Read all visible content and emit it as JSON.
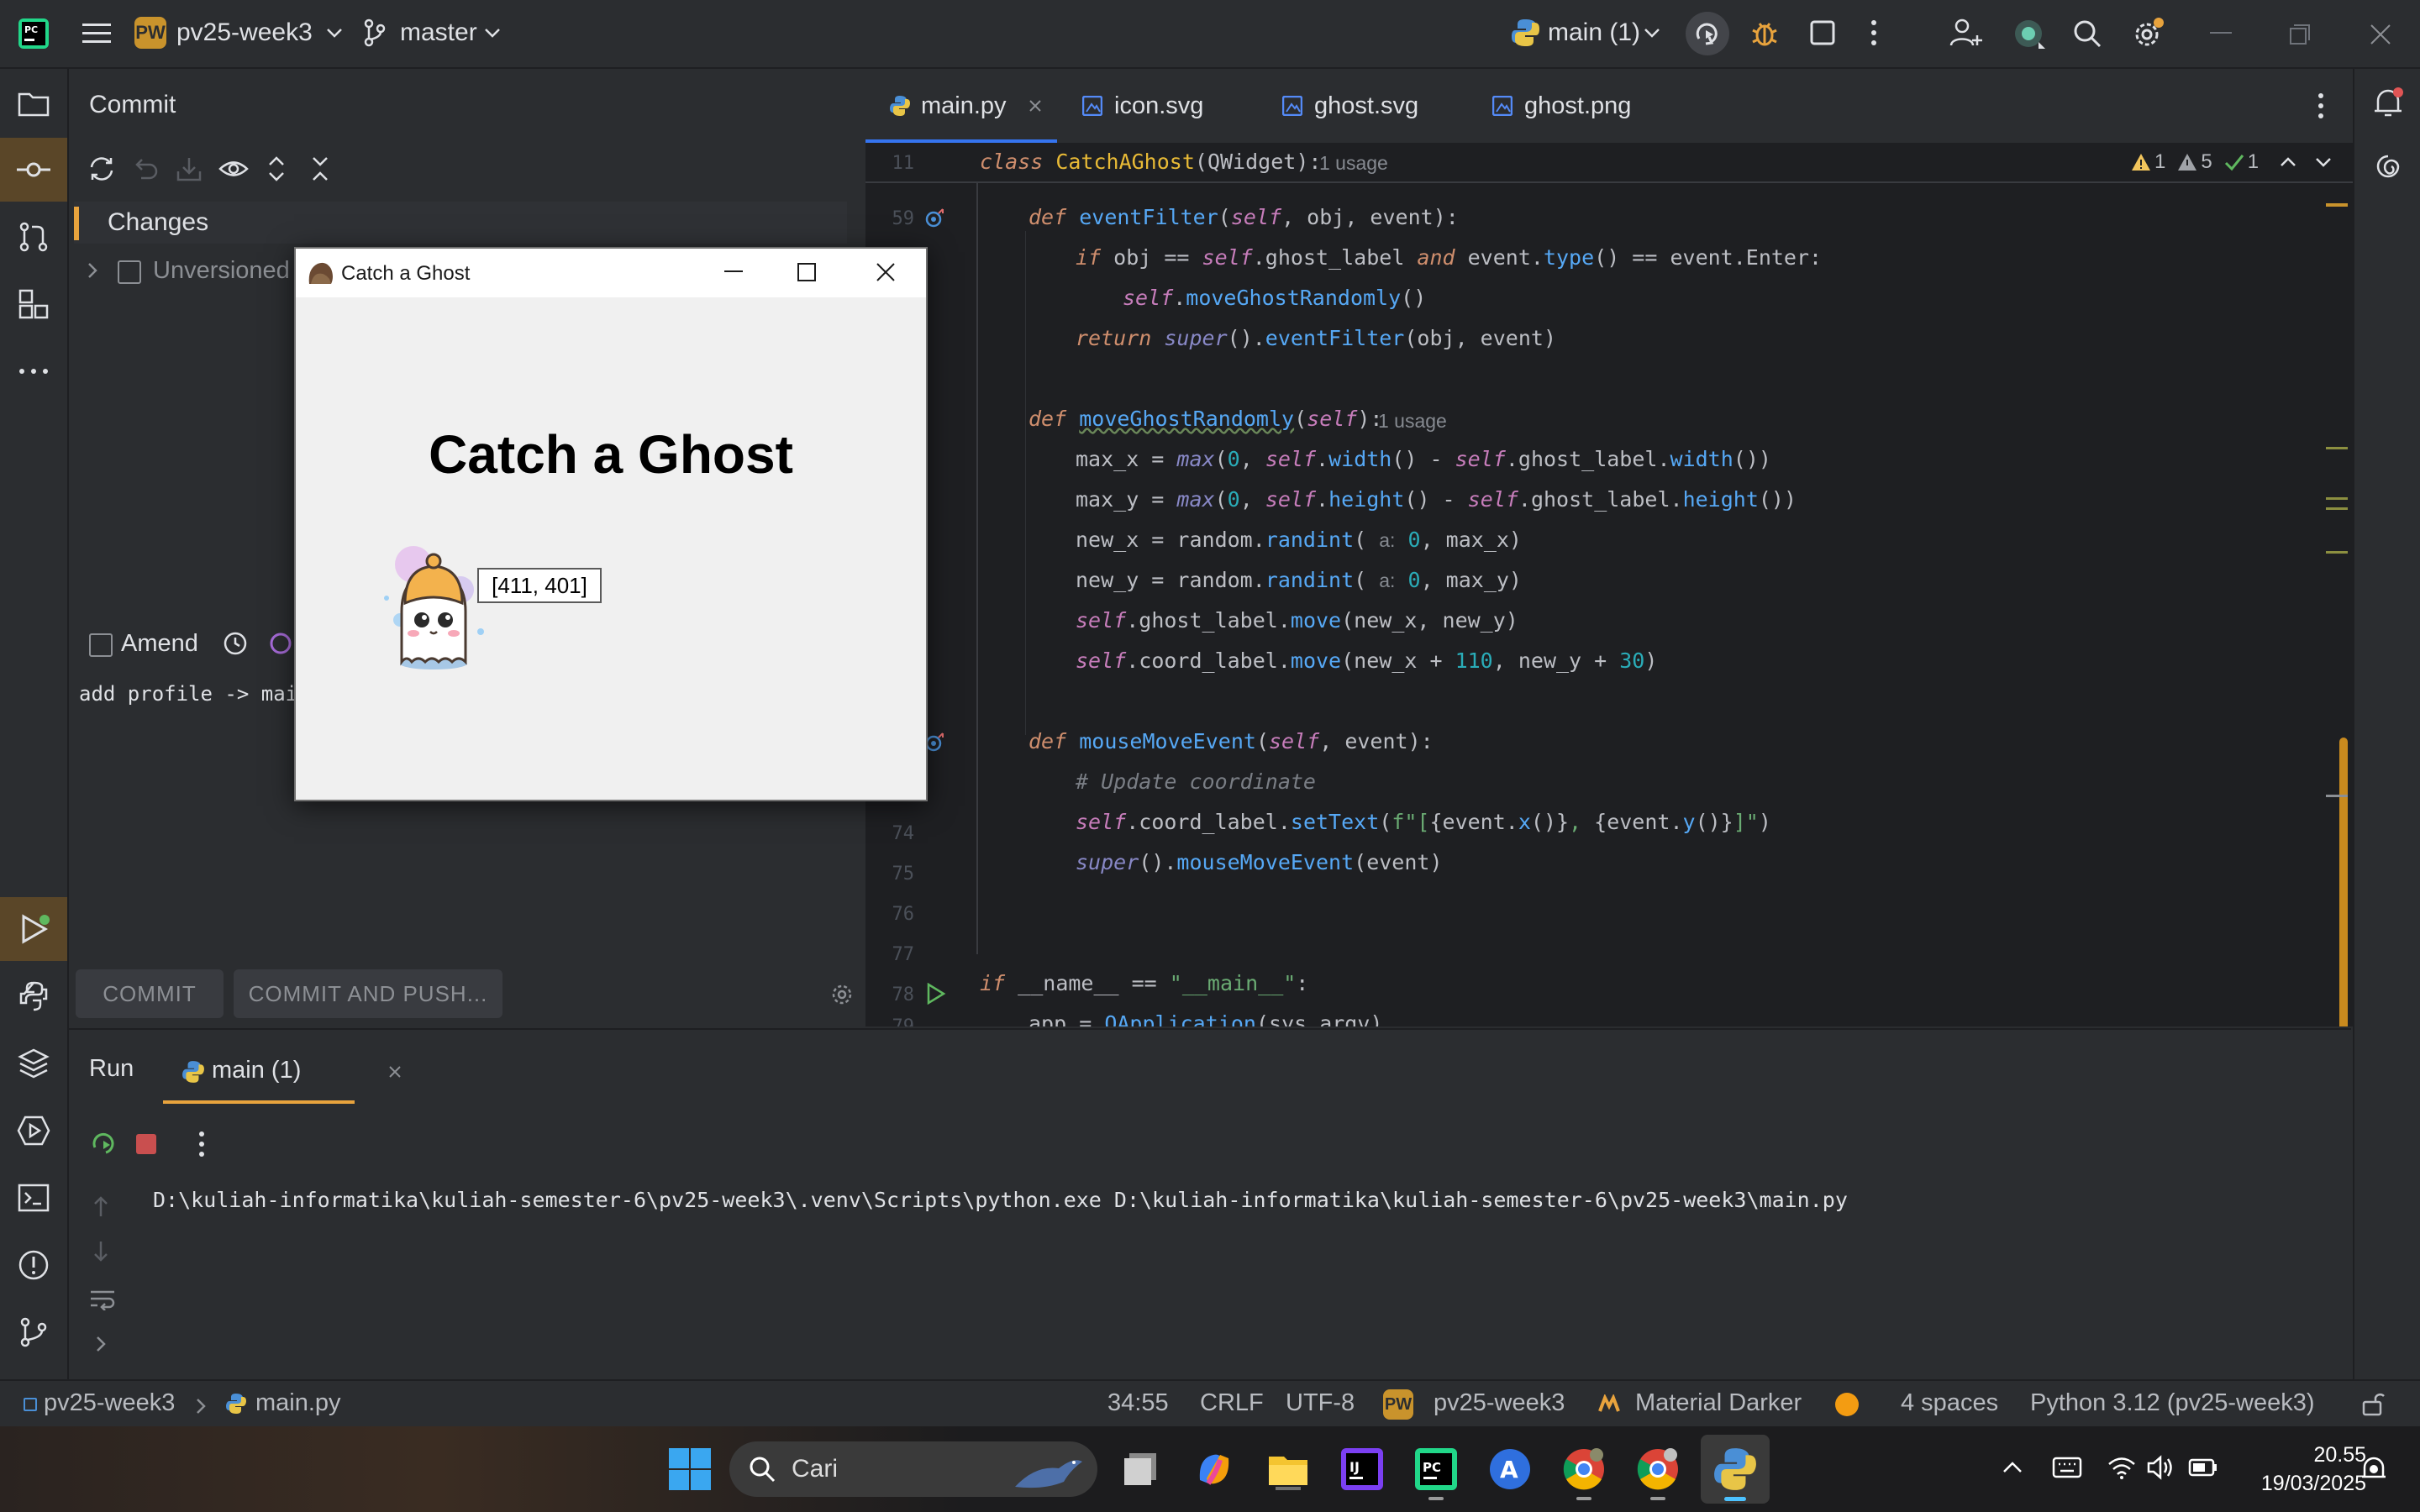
{
  "titlebar": {
    "project_badge": "PW",
    "project_name": "pv25-week3",
    "branch": "master",
    "run_config": "main (1)"
  },
  "commit_panel": {
    "title": "Commit",
    "changes_label": "Changes",
    "unversioned_label": "Unversioned",
    "amend_label": "Amend",
    "message": "add profile -> mai",
    "commit_button": "COMMIT",
    "commit_push_button": "COMMIT AND PUSH..."
  },
  "editor": {
    "tabs": [
      {
        "label": "main.py",
        "active": true
      },
      {
        "label": "icon.svg"
      },
      {
        "label": "ghost.svg"
      },
      {
        "label": "ghost.png"
      }
    ],
    "sticky_line": {
      "num": "11",
      "usage": "1 usage"
    },
    "inspections": {
      "warnings": "1",
      "weak": "5",
      "ok": "1"
    },
    "line_numbers": {
      "l59": "59",
      "l74": "74",
      "l75": "75",
      "l76": "76",
      "l77": "77",
      "l78": "78",
      "l79": "79"
    },
    "usage_hint": "1 usage",
    "param_hint": "a:"
  },
  "popup": {
    "window_title": "Catch a Ghost",
    "heading": "Catch a Ghost",
    "coord_label": "[411, 401]"
  },
  "run_panel": {
    "title": "Run",
    "tab_label": "main (1)",
    "output": "D:\\kuliah-informatika\\kuliah-semester-6\\pv25-week3\\.venv\\Scripts\\python.exe D:\\kuliah-informatika\\kuliah-semester-6\\pv25-week3\\main.py"
  },
  "statusbar": {
    "project": "pv25-week3",
    "file": "main.py",
    "position": "34:55",
    "line_sep": "CRLF",
    "encoding": "UTF-8",
    "badge": "PW",
    "project2": "pv25-week3",
    "theme": "Material Darker",
    "indent": "4 spaces",
    "interpreter": "Python 3.12 (pv25-week3)"
  },
  "taskbar": {
    "search_label": "Cari",
    "time": "20.55",
    "date": "19/03/2025"
  },
  "colors": {
    "accent_orange": "#e8a33d",
    "active_strip": "#5a4628",
    "editor_bg": "#1e1f22",
    "panel_bg": "#2b2d30"
  }
}
